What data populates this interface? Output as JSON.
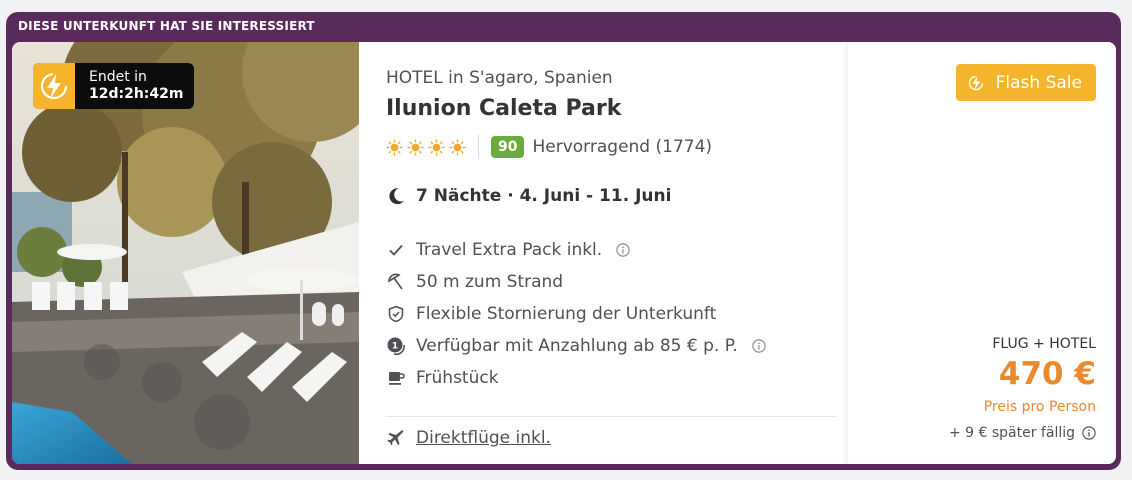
{
  "banner": {
    "label": "DIESE UNTERKUNFT HAT SIE INTERESSIERT"
  },
  "deal": {
    "ends_label": "Endet in",
    "countdown": "12d:2h:42m"
  },
  "hotel": {
    "type_location": "HOTEL in S'agaro, Spanien",
    "name": "Ilunion Caleta Park",
    "stars": 4,
    "score": "90",
    "score_text": "Hervorragend (1774)"
  },
  "stay": {
    "nights": "7 Nächte · 4. Juni - 11. Juni"
  },
  "features": [
    {
      "icon": "check-icon",
      "label": "Travel Extra Pack inkl.",
      "info": true
    },
    {
      "icon": "beach-umbrella-icon",
      "label": "50 m zum Strand",
      "info": false
    },
    {
      "icon": "shield-check-icon",
      "label": "Flexible Stornierung der Unterkunft",
      "info": false
    },
    {
      "icon": "deposit-coin-icon",
      "label": "Verfügbar mit Anzahlung ab 85 € p. P.",
      "info": true
    },
    {
      "icon": "coffee-cup-icon",
      "label": "Frühstück",
      "info": false
    }
  ],
  "flights": {
    "label": "Direktflüge inkl."
  },
  "pricing": {
    "flash_label": "Flash Sale",
    "package": "FLUG + HOTEL",
    "price": "470 €",
    "per_person": "Preis pro Person",
    "later_due": "+ 9 € später fällig"
  },
  "colors": {
    "frame": "#5a2a5c",
    "accent": "#f4b42b",
    "price": "#ea8a2f",
    "score": "#6aab3c"
  }
}
